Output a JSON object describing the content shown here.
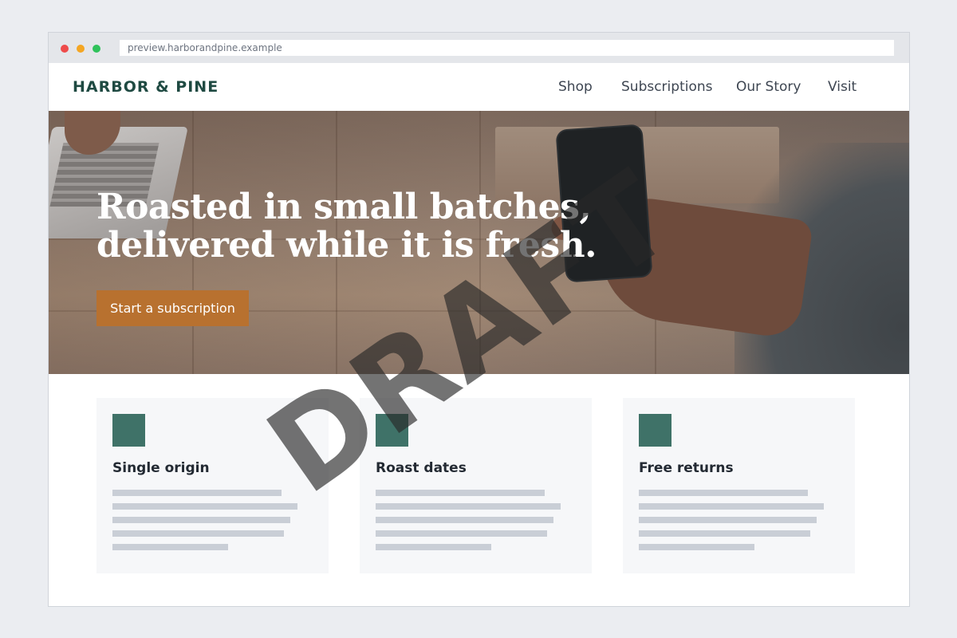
{
  "browser": {
    "url": "preview.harborandpine.example",
    "window_controls": [
      {
        "name": "close",
        "color": "#ee4b4b"
      },
      {
        "name": "minimize",
        "color": "#f4a623"
      },
      {
        "name": "maximize",
        "color": "#2fc25b"
      }
    ]
  },
  "site": {
    "brand": "HARBOR & PINE",
    "brand_color": "#1f4a42",
    "nav": [
      "Shop",
      "Subscriptions",
      "Our Story",
      "Visit"
    ]
  },
  "hero": {
    "headline": "Roasted in small batches, delivered while it is fresh.",
    "cta_label": "Start a subscription",
    "cta_color": "#b8712f",
    "image_subject": "hand holding phone over wooden table"
  },
  "features": [
    {
      "title": "Single origin",
      "icon": "square-icon"
    },
    {
      "title": "Roast dates",
      "icon": "square-icon"
    },
    {
      "title": "Free returns",
      "icon": "square-icon"
    }
  ],
  "colors": {
    "accent": "#3f7268",
    "placeholder_line": "#c9ced6"
  },
  "watermark": "DRAFT"
}
